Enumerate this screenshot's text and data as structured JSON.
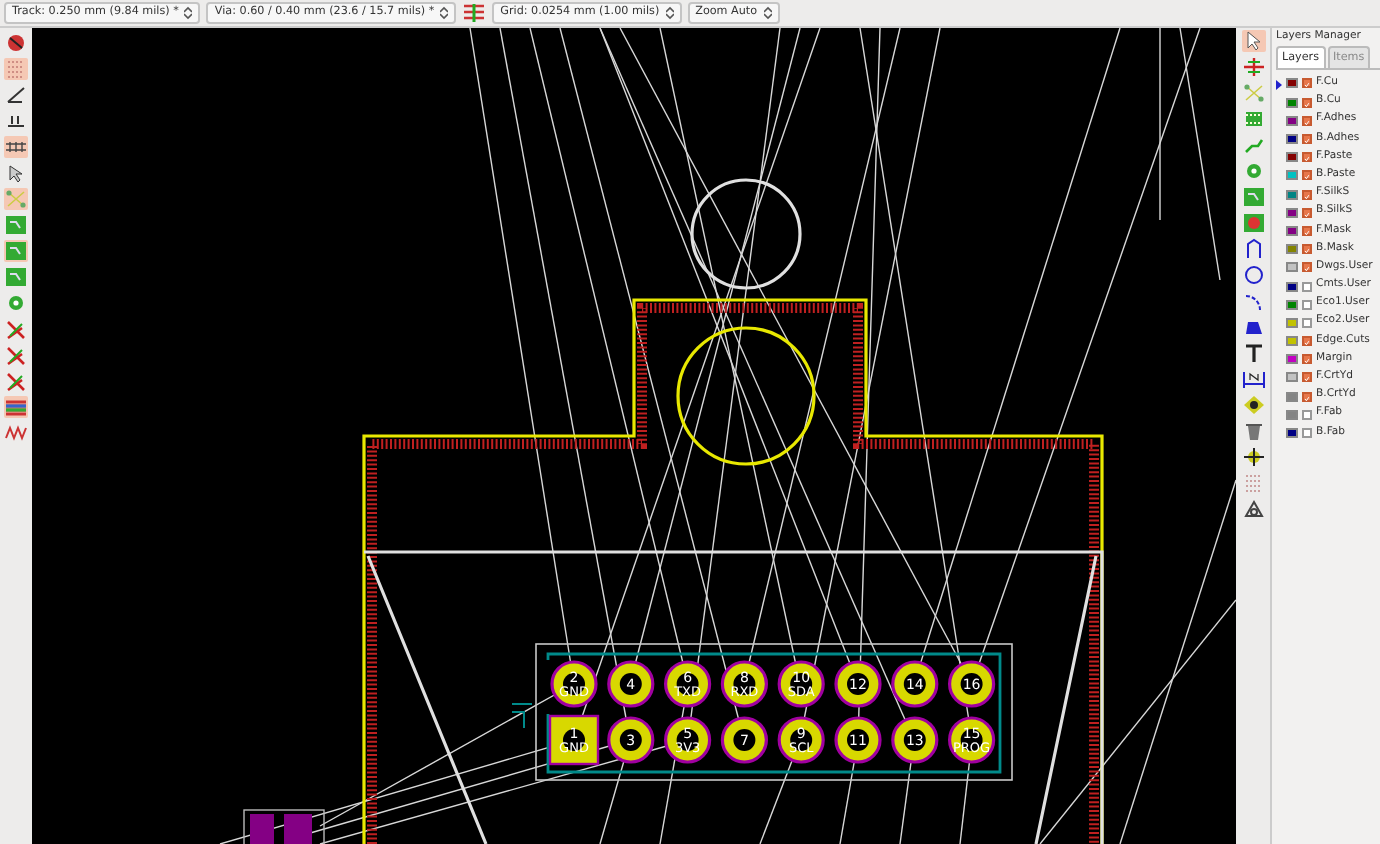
{
  "toolbar": {
    "track": "Track: 0.250 mm (9.84 mils) *",
    "via": "Via: 0.60 / 0.40 mm (23.6 / 15.7 mils) *",
    "grid": "Grid: 0.0254 mm (1.00 mils)",
    "zoom": "Zoom Auto"
  },
  "left_tools": [
    {
      "kind": "drc",
      "active": false
    },
    {
      "kind": "grid",
      "active": true
    },
    {
      "kind": "polar",
      "active": false
    },
    {
      "kind": "inch",
      "active": false
    },
    {
      "kind": "mm",
      "active": true
    },
    {
      "kind": "cursor",
      "active": false
    },
    {
      "kind": "ratsnest",
      "active": true
    },
    {
      "kind": "zone",
      "active": false
    },
    {
      "kind": "zone",
      "active": true
    },
    {
      "kind": "zone",
      "active": false
    },
    {
      "kind": "via",
      "active": false
    },
    {
      "kind": "track",
      "active": false
    },
    {
      "kind": "track",
      "active": false
    },
    {
      "kind": "track",
      "active": false
    },
    {
      "kind": "layers",
      "active": true
    },
    {
      "kind": "wave",
      "active": false
    }
  ],
  "right_tools": [
    {
      "kind": "arrow",
      "active": true
    },
    {
      "kind": "net",
      "active": false
    },
    {
      "kind": "ratsnest",
      "active": false
    },
    {
      "kind": "footprint",
      "active": false
    },
    {
      "kind": "route",
      "active": false
    },
    {
      "kind": "via",
      "active": false
    },
    {
      "kind": "zone",
      "active": false
    },
    {
      "kind": "keepout",
      "active": false
    },
    {
      "kind": "line",
      "active": false
    },
    {
      "kind": "circle",
      "active": false
    },
    {
      "kind": "arc",
      "active": false
    },
    {
      "kind": "polygon",
      "active": false
    },
    {
      "kind": "text",
      "active": false
    },
    {
      "kind": "dimension",
      "active": false
    },
    {
      "kind": "target",
      "active": false
    },
    {
      "kind": "delete",
      "active": false
    },
    {
      "kind": "origin",
      "active": false
    },
    {
      "kind": "grid",
      "active": false
    },
    {
      "kind": "measure",
      "active": false
    }
  ],
  "pads": [
    {
      "number": "2",
      "name": "GND",
      "kind": "round"
    },
    {
      "number": "4",
      "kind": "round"
    },
    {
      "number": "6",
      "name": "TXD",
      "kind": "round"
    },
    {
      "number": "8",
      "name": "RXD",
      "kind": "round"
    },
    {
      "number": "10",
      "name": "SDA",
      "kind": "round"
    },
    {
      "number": "12",
      "kind": "round"
    },
    {
      "number": "14",
      "kind": "round"
    },
    {
      "number": "16",
      "kind": "round"
    },
    {
      "number": "1",
      "name": "GND",
      "kind": "square"
    },
    {
      "number": "3",
      "kind": "round"
    },
    {
      "number": "5",
      "name": "3V3",
      "kind": "round"
    },
    {
      "number": "7",
      "kind": "round"
    },
    {
      "number": "9",
      "name": "SCL",
      "kind": "round"
    },
    {
      "number": "11",
      "kind": "round"
    },
    {
      "number": "13",
      "kind": "round"
    },
    {
      "number": "15",
      "name": "PROG",
      "kind": "round"
    }
  ],
  "layers_manager": {
    "title": "Layers Manager",
    "tabs": [
      {
        "label": "Layers",
        "selected": true
      },
      {
        "label": "Items",
        "selected": false
      }
    ],
    "layers": [
      {
        "name": "F.Cu",
        "color": "#840000",
        "checked": true,
        "selected": true
      },
      {
        "name": "B.Cu",
        "color": "#008400",
        "checked": true,
        "selected": false
      },
      {
        "name": "F.Adhes",
        "color": "#840084",
        "checked": true,
        "selected": false
      },
      {
        "name": "B.Adhes",
        "color": "#000084",
        "checked": true,
        "selected": false
      },
      {
        "name": "F.Paste",
        "color": "#840000",
        "checked": true,
        "selected": false
      },
      {
        "name": "B.Paste",
        "color": "#00c2c2",
        "checked": true,
        "selected": false
      },
      {
        "name": "F.SilkS",
        "color": "#008484",
        "checked": true,
        "selected": false
      },
      {
        "name": "B.SilkS",
        "color": "#840084",
        "checked": true,
        "selected": false
      },
      {
        "name": "F.Mask",
        "color": "#840084",
        "checked": true,
        "selected": false
      },
      {
        "name": "B.Mask",
        "color": "#848400",
        "checked": true,
        "selected": false
      },
      {
        "name": "Dwgs.User",
        "color": "#c2c2c2",
        "checked": true,
        "selected": false
      },
      {
        "name": "Cmts.User",
        "color": "#000084",
        "checked": false,
        "selected": false
      },
      {
        "name": "Eco1.User",
        "color": "#008400",
        "checked": false,
        "selected": false
      },
      {
        "name": "Eco2.User",
        "color": "#c2c200",
        "checked": false,
        "selected": false
      },
      {
        "name": "Edge.Cuts",
        "color": "#c2c200",
        "checked": true,
        "selected": false
      },
      {
        "name": "Margin",
        "color": "#c200c2",
        "checked": true,
        "selected": false
      },
      {
        "name": "F.CrtYd",
        "color": "#c2c2c2",
        "checked": true,
        "selected": false
      },
      {
        "name": "B.CrtYd",
        "color": "#848484",
        "checked": true,
        "selected": false
      },
      {
        "name": "F.Fab",
        "color": "#848484",
        "checked": false,
        "selected": false
      },
      {
        "name": "B.Fab",
        "color": "#000084",
        "checked": false,
        "selected": false
      }
    ]
  }
}
